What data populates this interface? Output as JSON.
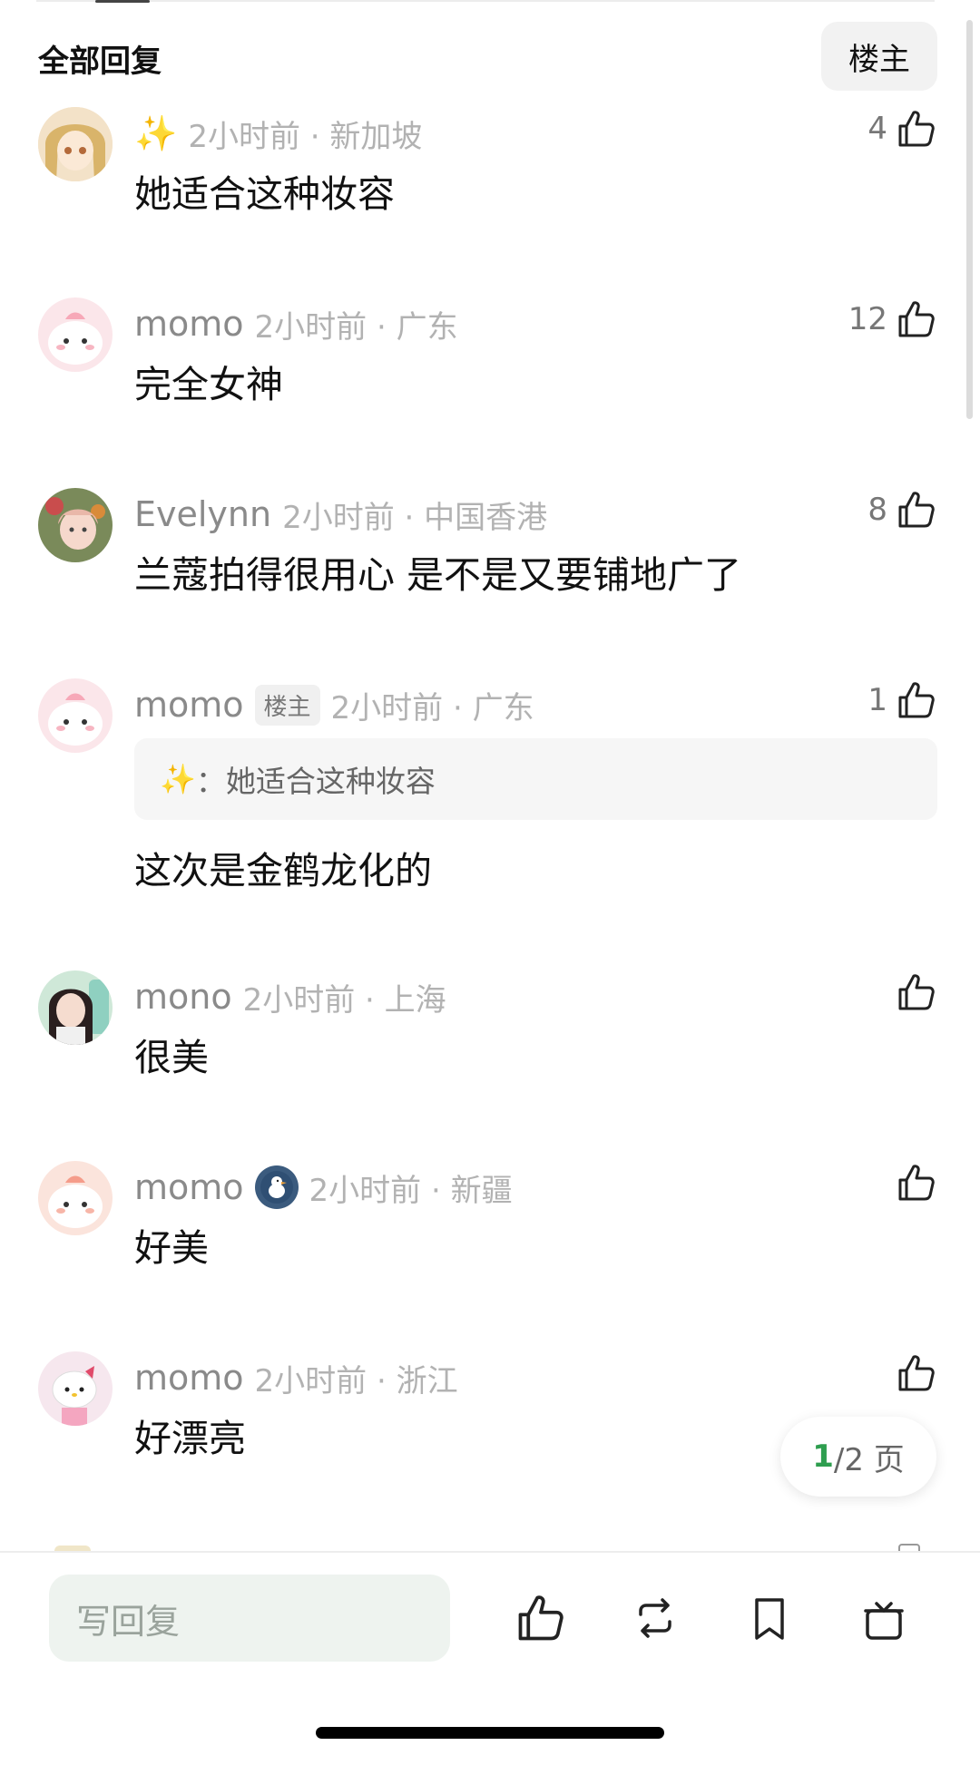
{
  "header": {
    "title": "全部回复",
    "filter_label": "楼主"
  },
  "comments": [
    {
      "user": "",
      "time_location": "2小时前 · 新加坡",
      "text": "她适合这种妆容",
      "likes": "4"
    },
    {
      "user": "momo",
      "time_location": "2小时前 · 广东",
      "text": "完全女神",
      "likes": "12"
    },
    {
      "user": "Evelynn",
      "time_location": "2小时前 · 中国香港",
      "text": "兰蔻拍得很用心 是不是又要铺地广了",
      "likes": "8"
    },
    {
      "user": "momo",
      "op_tag": "楼主",
      "time_location": "2小时前 · 广东",
      "quote": "：她适合这种妆容",
      "text": "这次是金鹤龙化的",
      "likes": "1"
    },
    {
      "user": "mono",
      "time_location": "2小时前 · 上海",
      "text": "很美",
      "likes": ""
    },
    {
      "user": "momo",
      "time_location": "2小时前 · 新疆",
      "text": "好美",
      "likes": ""
    },
    {
      "user": "momo",
      "time_location": "2小时前 · 浙江",
      "text": "好漂亮",
      "likes": ""
    }
  ],
  "pagination": {
    "current": "1",
    "total_suffix": "/2 页"
  },
  "bottom_bar": {
    "reply_placeholder": "写回复",
    "icons": [
      "thumbs-up-icon",
      "repost-icon",
      "bookmark-icon",
      "gift-icon"
    ]
  },
  "colors": {
    "accent_green": "#2e9e4f",
    "meta_gray": "#8a8a8a",
    "input_bg": "#eef3ef"
  }
}
